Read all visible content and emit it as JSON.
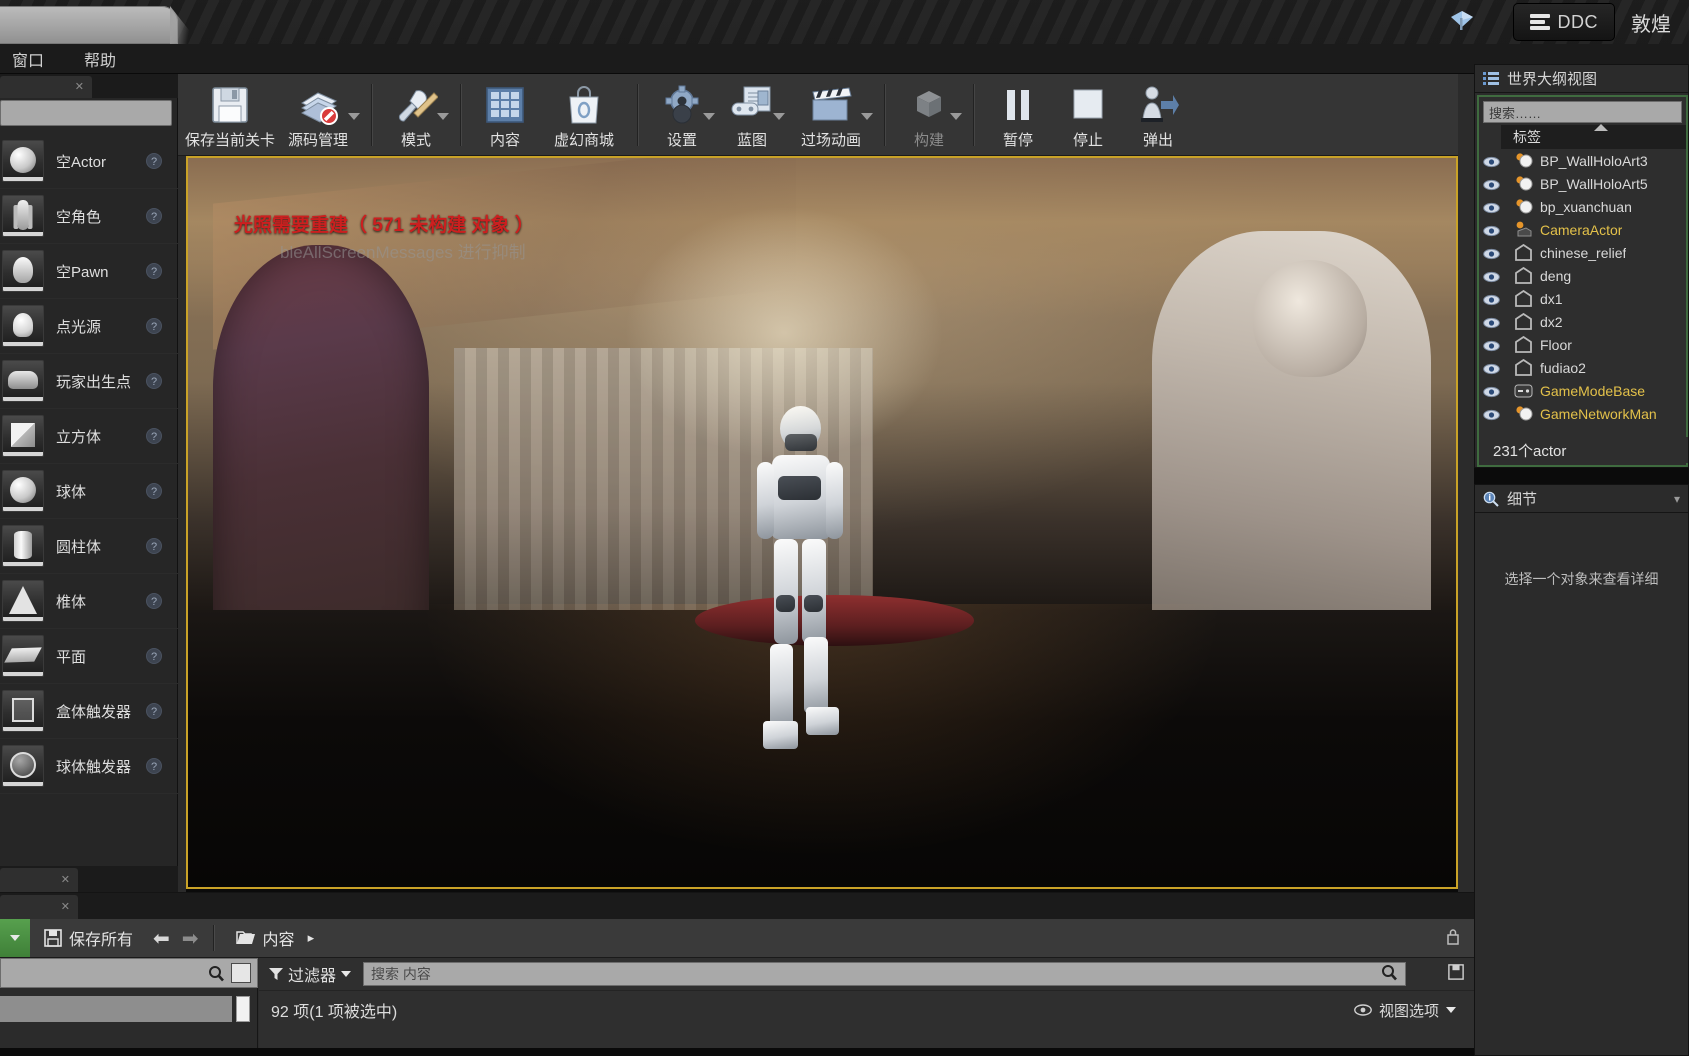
{
  "titlebar": {
    "ddc_label": "DDC",
    "project_title": "敦煌",
    "ddc_icon": "server-stack-icon",
    "gem_icon": "unreal-gem-icon"
  },
  "menubar": {
    "items": [
      {
        "label": "窗口"
      },
      {
        "label": "帮助"
      }
    ]
  },
  "place_actors": {
    "search_placeholder": "",
    "search_value": "",
    "search_icon": "search-icon",
    "items": [
      {
        "label": "空Actor",
        "icon": "sphere-thumb-icon",
        "help": "?"
      },
      {
        "label": "空角色",
        "icon": "character-thumb-icon",
        "help": "?"
      },
      {
        "label": "空Pawn",
        "icon": "pawn-thumb-icon",
        "help": "?"
      },
      {
        "label": "点光源",
        "icon": "point-light-thumb-icon",
        "help": "?"
      },
      {
        "label": "玩家出生点",
        "icon": "player-start-thumb-icon",
        "help": "?"
      },
      {
        "label": "立方体",
        "icon": "cube-thumb-icon",
        "help": "?"
      },
      {
        "label": "球体",
        "icon": "sphere-thumb-icon",
        "help": "?"
      },
      {
        "label": "圆柱体",
        "icon": "cylinder-thumb-icon",
        "help": "?"
      },
      {
        "label": "椎体",
        "icon": "cone-thumb-icon",
        "help": "?"
      },
      {
        "label": "平面",
        "icon": "plane-thumb-icon",
        "help": "?"
      },
      {
        "label": "盒体触发器",
        "icon": "box-trigger-thumb-icon",
        "help": "?"
      },
      {
        "label": "球体触发器",
        "icon": "sphere-trigger-thumb-icon",
        "help": "?"
      }
    ]
  },
  "toolbar": {
    "items": [
      {
        "label": "保存当前关卡",
        "icon": "floppy-save-icon",
        "caret": false,
        "dim": false
      },
      {
        "label": "源码管理",
        "icon": "source-control-icon",
        "caret": true,
        "dim": false
      },
      {
        "label": "模式",
        "icon": "wrench-pencil-icon",
        "caret": true,
        "dim": false
      },
      {
        "label": "内容",
        "icon": "content-grid-icon",
        "caret": false,
        "dim": false
      },
      {
        "label": "虚幻商城",
        "icon": "marketplace-bag-icon",
        "caret": false,
        "dim": false
      },
      {
        "label": "设置",
        "icon": "gear-settings-icon",
        "caret": true,
        "dim": false
      },
      {
        "label": "蓝图",
        "icon": "blueprint-icon",
        "caret": true,
        "dim": false
      },
      {
        "label": "过场动画",
        "icon": "clapperboard-icon",
        "caret": true,
        "dim": false
      },
      {
        "label": "构建",
        "icon": "build-blocks-icon",
        "caret": true,
        "dim": true
      },
      {
        "label": "暂停",
        "icon": "pause-icon",
        "caret": false,
        "dim": false
      },
      {
        "label": "停止",
        "icon": "stop-icon",
        "caret": false,
        "dim": false
      },
      {
        "label": "弹出",
        "icon": "eject-person-icon",
        "caret": false,
        "dim": false
      }
    ],
    "separator_after": [
      1,
      2,
      4,
      7,
      8
    ]
  },
  "viewport": {
    "warning_line1": "光照需要重建（ 571 未构建 对象 ）",
    "warning_line2": "bleAllScreenMessages 进行抑制",
    "border_color": "#c9a227",
    "warning_color": "#cc1f1f"
  },
  "outliner": {
    "title": "世界大纲视图",
    "title_icon": "outliner-list-icon",
    "search_placeholder": "搜索……",
    "column_label": "标签",
    "count_label": "231个actor",
    "rows": [
      {
        "name": "BP_WallHoloArt3",
        "icon": "blueprint-actor-icon",
        "highlight": false
      },
      {
        "name": "BP_WallHoloArt5",
        "icon": "blueprint-actor-icon",
        "highlight": false
      },
      {
        "name": "bp_xuanchuan",
        "icon": "blueprint-actor-icon",
        "highlight": false
      },
      {
        "name": "CameraActor",
        "icon": "camera-actor-icon",
        "highlight": true
      },
      {
        "name": "chinese_relief",
        "icon": "static-mesh-icon",
        "highlight": false
      },
      {
        "name": "deng",
        "icon": "static-mesh-icon",
        "highlight": false
      },
      {
        "name": "dx1",
        "icon": "static-mesh-icon",
        "highlight": false
      },
      {
        "name": "dx2",
        "icon": "static-mesh-icon",
        "highlight": false
      },
      {
        "name": "Floor",
        "icon": "static-mesh-icon",
        "highlight": false
      },
      {
        "name": "fudiao2",
        "icon": "static-mesh-icon",
        "highlight": false
      },
      {
        "name": "GameModeBase",
        "icon": "gamemode-icon",
        "highlight": true
      },
      {
        "name": "GameNetworkMan",
        "icon": "blueprint-actor-icon",
        "highlight": true
      }
    ]
  },
  "details": {
    "title": "细节",
    "title_icon": "magnifier-info-icon",
    "empty_message": "选择一个对象来查看详细"
  },
  "content_browser": {
    "save_all_label": "保存所有",
    "save_icon": "floppy-save-icon",
    "back_icon": "arrow-left-icon",
    "forward_icon": "arrow-right-icon",
    "folder_icon": "folder-icon",
    "breadcrumb": "内容",
    "breadcrumb_caret": "▸",
    "lock_icon": "lock-icon",
    "left_search_icon": "search-icon",
    "left_list_icon": "list-view-icon",
    "filter_label": "过滤器",
    "filter_icon": "funnel-icon",
    "search_placeholder": "搜索 内容",
    "status_label": "92 项(1 项被选中)",
    "view_options_label": "视图选项",
    "view_options_icon": "eye-icon"
  }
}
